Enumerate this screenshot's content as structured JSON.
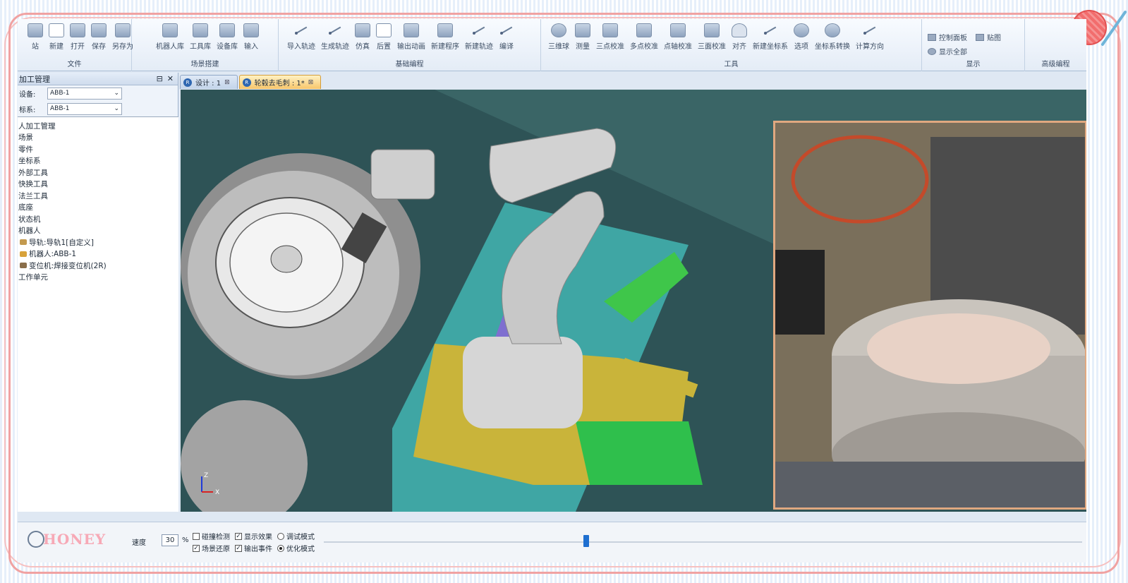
{
  "ribbon": {
    "groups": [
      {
        "title": "文件",
        "items": [
          "站",
          "新建",
          "打开",
          "保存",
          "另存为"
        ]
      },
      {
        "title": "场景搭建",
        "items": [
          "机器人库",
          "工具库",
          "设备库",
          "输入"
        ]
      },
      {
        "title": "基础编程",
        "items": [
          "导入轨迹",
          "生成轨迹",
          "仿真",
          "后置",
          "输出动画",
          "新建程序",
          "新建轨迹",
          "编译"
        ]
      },
      {
        "title": "工具",
        "items": [
          "三维球",
          "测量",
          "三点校准",
          "多点校准",
          "点轴校准",
          "三面校准",
          "对齐",
          "新建坐标系",
          "选项",
          "坐标系转换",
          "计算方向"
        ]
      },
      {
        "title": "显示",
        "items": [
          "控制面板",
          "贴图",
          "显示全部"
        ]
      },
      {
        "title": "高级编程",
        "items": []
      }
    ]
  },
  "panel": {
    "title": "加工管理",
    "device_label": "设备:",
    "device_value": "ABB-1",
    "frame_label": "标系:",
    "frame_value": "ABB-1",
    "tree": [
      "人加工管理",
      "场景",
      "零件",
      "坐标系",
      "外部工具",
      "快换工具",
      "法兰工具",
      "底座",
      "状态机",
      "机器人",
      "导轨:导轨1[自定义]",
      "机器人:ABB-1",
      "变位机:焊接变位机(2R)",
      "工作单元"
    ]
  },
  "tabs": [
    {
      "label": "设计 : 1"
    },
    {
      "label": "轮毂去毛刺 : 1*"
    }
  ],
  "axis": {
    "z": "Z",
    "x": "X"
  },
  "bottom": {
    "speed_label": "速度",
    "speed_value": "30",
    "percent": "%",
    "checks": [
      {
        "label": "碰撞检测",
        "checked": false
      },
      {
        "label": "显示效果",
        "checked": true
      },
      {
        "label": "场景还原",
        "checked": true
      },
      {
        "label": "输出事件",
        "checked": true
      }
    ],
    "radios": [
      {
        "label": "调试模式",
        "selected": false
      },
      {
        "label": "优化模式",
        "selected": true
      }
    ],
    "watermark": "HONEY"
  },
  "colors": {
    "viewport_bg": "#2e5356",
    "active_tab": "#f8c56a",
    "frame": "#f0a2a2"
  }
}
